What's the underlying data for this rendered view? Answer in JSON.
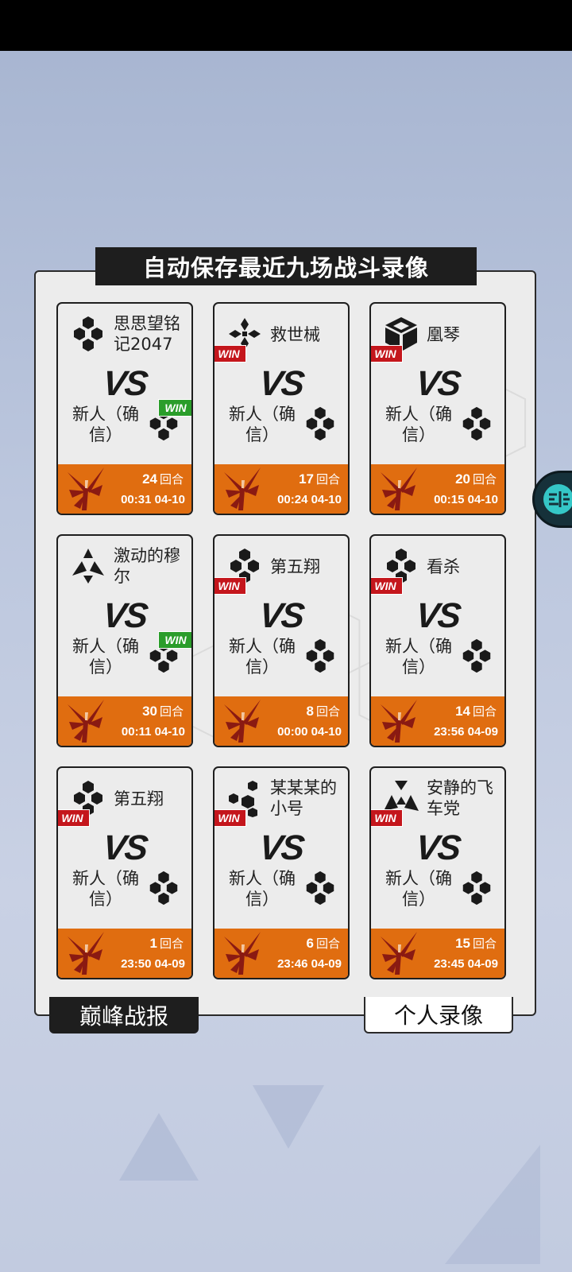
{
  "title": "自动保存最近九场战斗录像",
  "vs_label": "VS",
  "win_label": "WIN",
  "rounds_unit": "回合",
  "tabs": {
    "left": "巅峰战报",
    "right": "个人录像"
  },
  "colors": {
    "accent_orange": "#e06d10",
    "win_red": "#c4161c",
    "win_green": "#2a9d2a"
  },
  "records": [
    {
      "p1": "思思望铭记2047",
      "p1_icon": "hex-cluster-icon",
      "p1_win": false,
      "p2": "新人（确信）",
      "p2_win": true,
      "rounds": "24",
      "time": "00:31 04-10"
    },
    {
      "p1": "救世械",
      "p1_icon": "cross-diamond-icon",
      "p1_win": true,
      "p2": "新人（确信）",
      "p2_win": false,
      "rounds": "17",
      "time": "00:24 04-10"
    },
    {
      "p1": "凰琴",
      "p1_icon": "cube-icon",
      "p1_win": true,
      "p2": "新人（确信）",
      "p2_win": false,
      "rounds": "20",
      "time": "00:15 04-10"
    },
    {
      "p1": "激动的穆尔",
      "p1_icon": "triangle-star-icon",
      "p1_win": false,
      "p2": "新人（确信）",
      "p2_win": true,
      "rounds": "30",
      "time": "00:11 04-10"
    },
    {
      "p1": "第五翔",
      "p1_icon": "hex-cluster-icon",
      "p1_win": true,
      "p2": "新人（确信）",
      "p2_win": false,
      "rounds": "8",
      "time": "00:00 04-10"
    },
    {
      "p1": "看杀",
      "p1_icon": "hex-cluster-icon",
      "p1_win": true,
      "p2": "新人（确信）",
      "p2_win": false,
      "rounds": "14",
      "time": "23:56 04-09"
    },
    {
      "p1": "第五翔",
      "p1_icon": "hex-cluster-icon",
      "p1_win": true,
      "p2": "新人（确信）",
      "p2_win": false,
      "rounds": "1",
      "time": "23:50 04-09"
    },
    {
      "p1": "某某某的小号",
      "p1_icon": "scattered-hex-icon",
      "p1_win": true,
      "p2": "新人（确信）",
      "p2_win": false,
      "rounds": "6",
      "time": "23:46 04-09"
    },
    {
      "p1": "安静的飞车党",
      "p1_icon": "triangle-cluster-icon",
      "p1_win": true,
      "p2": "新人（确信）",
      "p2_win": false,
      "rounds": "15",
      "time": "23:45 04-09"
    }
  ]
}
